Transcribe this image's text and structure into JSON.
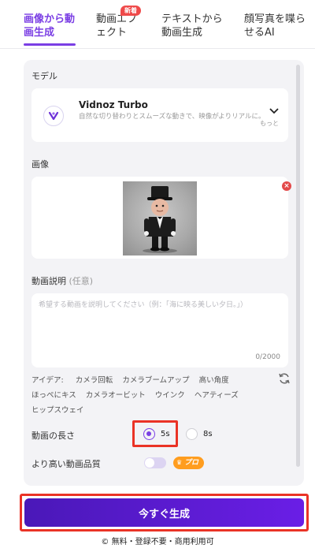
{
  "tabs": [
    {
      "label": "画像から動画生成",
      "active": true
    },
    {
      "label": "動画エフェクト",
      "badge": "新着"
    },
    {
      "label": "テキストから動画生成"
    },
    {
      "label": "顔写真を喋らせるAI"
    }
  ],
  "model": {
    "section_label": "モデル",
    "name": "Vidnoz Turbo",
    "description": "自然な切り替わりとスムーズな動きで、映像がよりリアルに。",
    "more_label": "もっと"
  },
  "image": {
    "section_label": "画像"
  },
  "description": {
    "section_label": "動画説明",
    "optional_label": "(任意)",
    "placeholder": "希望する動画を説明してください（例：「海に映る美しい夕日。」）",
    "counter": "0/2000"
  },
  "ideas": {
    "label": "アイデア:",
    "row1": [
      "カメラ回転",
      "カメラブームアップ",
      "高い角度"
    ],
    "row2": [
      "ほっぺにキス",
      "カメラオービット",
      "ウインク",
      "ヘアティーズ"
    ],
    "row3": [
      "ヒップスウェイ"
    ]
  },
  "duration": {
    "label": "動画の長さ",
    "options": [
      {
        "label": "5s",
        "selected": true
      },
      {
        "label": "8s",
        "selected": false
      }
    ]
  },
  "quality": {
    "label": "より高い動画品質",
    "enabled": false,
    "pro_label": "プロ"
  },
  "generate_button": "今すぐ生成",
  "footer": "© 無料・登録不要・商用利用可",
  "colors": {
    "accent": "#7b3fe4",
    "button_start": "#4a18b8",
    "button_end": "#6a1ee6",
    "highlight": "#ea3326",
    "pro": "#ff9d1f",
    "remove": "#e34a4a"
  }
}
